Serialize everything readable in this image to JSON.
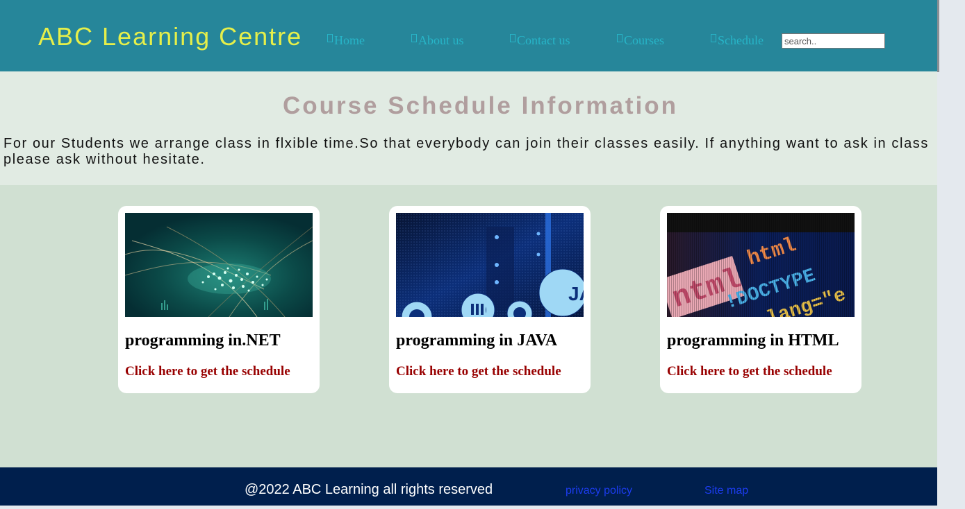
{
  "header": {
    "logo": "ABC Learning Centre",
    "nav": [
      {
        "label": "Home",
        "icon": "page-icon"
      },
      {
        "label": "About us",
        "icon": "page-icon"
      },
      {
        "label": "Contact us",
        "icon": "page-icon"
      },
      {
        "label": "Courses",
        "icon": "page-icon"
      },
      {
        "label": "Schedule",
        "icon": "page-icon"
      }
    ],
    "search": {
      "placeholder": "search..",
      "value": ""
    }
  },
  "intro": {
    "title": "Course Schedule Information",
    "text": "For our Students we arrange class in flxible time.So that everybody can join their classes easily. If anything want to ask in class please ask without hesitate."
  },
  "courses": [
    {
      "title": "programming in.NET",
      "link": "Click here to get the schedule",
      "image": "network-fiber-image"
    },
    {
      "title": "programming in JAVA",
      "link": "Click here to get the schedule",
      "image": "java-server-image"
    },
    {
      "title": "programming in HTML",
      "link": "Click here to get the schedule",
      "image": "html-code-image"
    }
  ],
  "footer": {
    "copyright": "@2022 ABC Learning all rights reserved",
    "links": [
      "privacy policy",
      "Site map"
    ]
  },
  "colors": {
    "header_bg": "#26869a",
    "logo": "#e6ef4a",
    "nav_text": "#27b5c8",
    "intro_bg": "#e1ebe3",
    "title": "#b09e9e",
    "main_bg": "#d0e0d2",
    "link": "#980000",
    "footer_bg": "#001f4d",
    "footer_link": "#1c3cf0"
  }
}
